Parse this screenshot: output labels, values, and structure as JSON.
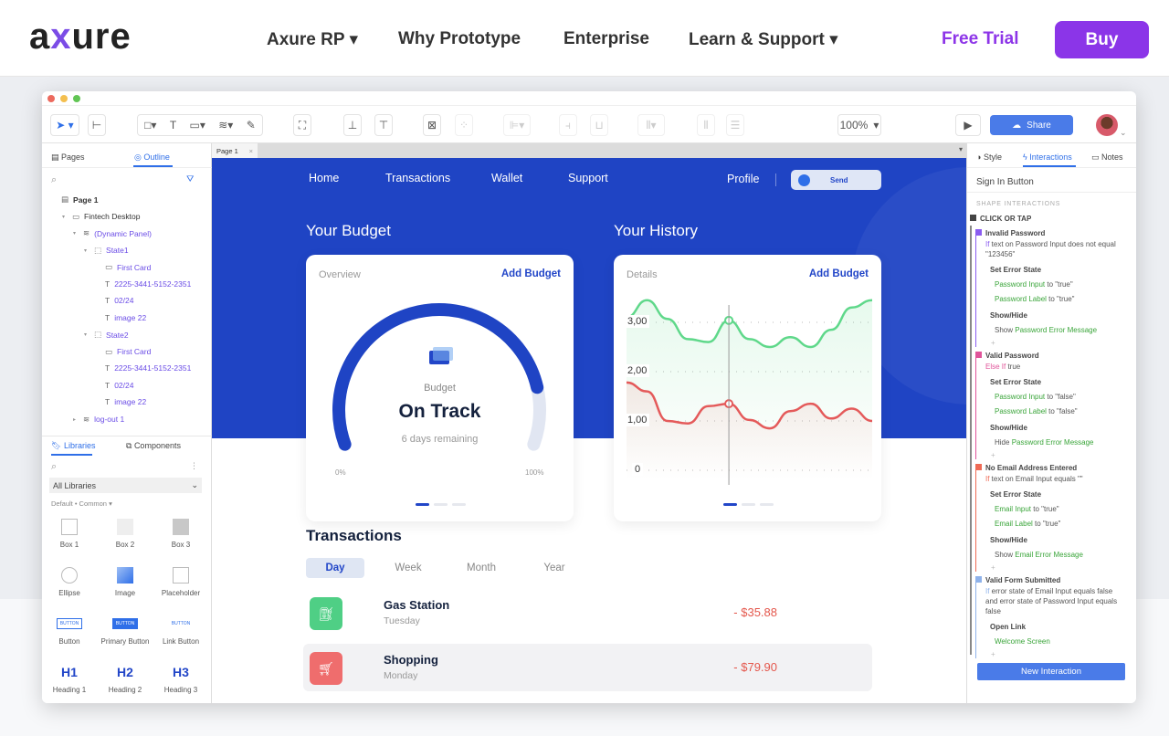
{
  "site_nav": {
    "logo": "axure",
    "items": [
      "Axure RP ▾",
      "Why Prototype",
      "Enterprise",
      "Learn & Support ▾"
    ],
    "free_trial": "Free Trial",
    "buy": "Buy"
  },
  "toolbar": {
    "zoom": "100%",
    "share": "Share"
  },
  "left_panel": {
    "tabs": [
      "Pages",
      "Outline"
    ],
    "outline": [
      {
        "label": "Page 1",
        "type": "page"
      },
      {
        "label": "Fintech Desktop",
        "type": "folder"
      },
      {
        "label": "(Dynamic Panel)",
        "type": "panel"
      },
      {
        "label": "State1",
        "type": "state"
      },
      {
        "label": "First Card",
        "type": "rect"
      },
      {
        "label": "2225-3441-5152-2351",
        "type": "text"
      },
      {
        "label": "02/24",
        "type": "text"
      },
      {
        "label": "image 22",
        "type": "text"
      },
      {
        "label": "State2",
        "type": "state"
      },
      {
        "label": "First Card",
        "type": "rect"
      },
      {
        "label": "2225-3441-5152-2351",
        "type": "text"
      },
      {
        "label": "02/24",
        "type": "text"
      },
      {
        "label": "image 22",
        "type": "text"
      },
      {
        "label": "log-out 1",
        "type": "panel"
      }
    ],
    "lib_tabs": [
      "Libraries",
      "Components"
    ],
    "library_select": "All Libraries",
    "library_path": "Default • Common ▾",
    "components": [
      {
        "label": "Box 1",
        "glyph": ""
      },
      {
        "label": "Box 2",
        "glyph": ""
      },
      {
        "label": "Box 3",
        "glyph": ""
      },
      {
        "label": "Ellipse",
        "glyph": ""
      },
      {
        "label": "Image",
        "glyph": ""
      },
      {
        "label": "Placeholder",
        "glyph": ""
      },
      {
        "label": "Button",
        "glyph": "BUTTON"
      },
      {
        "label": "Primary Button",
        "glyph": "BUTTON"
      },
      {
        "label": "Link Button",
        "glyph": "BUTTON"
      },
      {
        "label": "Heading 1",
        "glyph": "H1"
      },
      {
        "label": "Heading 2",
        "glyph": "H2"
      },
      {
        "label": "Heading 3",
        "glyph": "H3"
      }
    ]
  },
  "canvas": {
    "page_tab": "Page 1",
    "close": "×",
    "nav": [
      "Home",
      "Transactions",
      "Wallet",
      "Support"
    ],
    "profile": "Profile",
    "send": "Send",
    "budget": {
      "heading": "Your Budget",
      "card_title": "Overview",
      "add": "Add Budget",
      "label": "Budget",
      "status": "On Track",
      "remaining": "6 days remaining",
      "min": "0%",
      "max": "100%",
      "progress_percent": 85
    },
    "history": {
      "heading": "Your History",
      "card_title": "Details",
      "add": "Add Budget"
    },
    "transactions": {
      "heading": "Transactions",
      "tabs": [
        "Day",
        "Week",
        "Month",
        "Year"
      ],
      "active_tab": "Day",
      "rows": [
        {
          "name": "Gas Station",
          "day": "Tuesday",
          "amount": "- $35.88",
          "icon": "gas-pump",
          "color": "#4fcf85"
        },
        {
          "name": "Shopping",
          "day": "Monday",
          "amount": "- $79.90",
          "icon": "cart",
          "color": "#ef6d6d"
        }
      ]
    }
  },
  "chart_data": {
    "type": "line",
    "yticks": [
      "0",
      "1,00",
      "2,00",
      "3,00"
    ],
    "ylim": [
      0,
      3.6
    ],
    "grid": true,
    "series": [
      {
        "color": "#5fd88a",
        "values": [
          3.1,
          3.45,
          3.07,
          2.66,
          2.6,
          3.04,
          2.66,
          2.5,
          2.7,
          2.5,
          2.85,
          3.3,
          3.45
        ]
      },
      {
        "color": "#e45a5a",
        "values": [
          1.78,
          1.6,
          1.0,
          0.95,
          1.3,
          1.35,
          1.02,
          0.85,
          1.2,
          1.35,
          1.05,
          1.25,
          1.0
        ]
      }
    ],
    "marker_index": 5
  },
  "right_panel": {
    "tabs": [
      "Style",
      "Interactions",
      "Notes"
    ],
    "selected": "Sign In Button",
    "section": "SHAPE INTERACTIONS",
    "event": "CLICK OR TAP",
    "cases": [
      {
        "name": "Invalid Password",
        "color": "#8a5cf0",
        "cond_kw": "If",
        "cond": " text on Password Input does not equal \"123456\"",
        "actions": [
          {
            "title": "Set Error State",
            "lines": [
              [
                "Password Input",
                " to \"true\""
              ],
              [
                "Password Label",
                " to \"true\""
              ]
            ]
          },
          {
            "title": "Show/Hide",
            "lines": [
              [
                "Show ",
                "Password Error Message"
              ]
            ]
          }
        ]
      },
      {
        "name": "Valid Password",
        "color": "#e0549a",
        "cond_kw": "Else If",
        "cond": " true",
        "actions": [
          {
            "title": "Set Error State",
            "lines": [
              [
                "Password Input",
                " to \"false\""
              ],
              [
                "Password Label",
                " to \"false\""
              ]
            ]
          },
          {
            "title": "Show/Hide",
            "lines": [
              [
                "Hide ",
                "Password Error Message"
              ]
            ]
          }
        ]
      },
      {
        "name": "No Email Address Entered",
        "color": "#ef6a55",
        "cond_kw": "If",
        "cond": " text on Email Input equals \"\"",
        "actions": [
          {
            "title": "Set Error State",
            "lines": [
              [
                "Email Input",
                " to \"true\""
              ],
              [
                "Email Label",
                " to \"true\""
              ]
            ]
          },
          {
            "title": "Show/Hide",
            "lines": [
              [
                "Show ",
                "Email Error Message"
              ]
            ]
          }
        ]
      },
      {
        "name": "Valid Form Submitted",
        "color": "#8fb2ea",
        "cond_kw": "If",
        "cond": " error state of Email Input equals false and error state of Password Input equals false",
        "actions": [
          {
            "title": "Open Link",
            "lines": [
              [
                "Welcome Screen",
                ""
              ]
            ]
          }
        ]
      }
    ],
    "new_interaction": "New Interaction"
  }
}
